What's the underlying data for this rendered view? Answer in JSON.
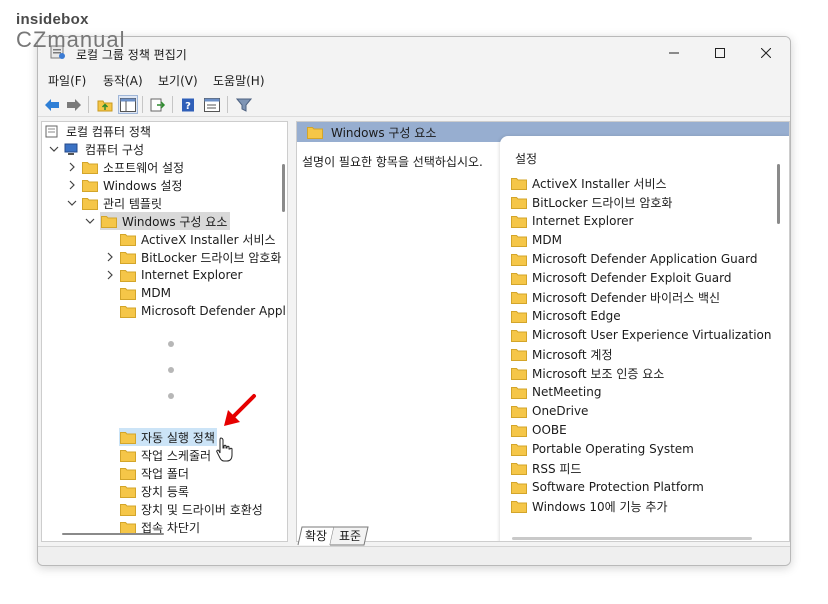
{
  "watermark": {
    "line1": "insidebox",
    "line2": "CZmanual"
  },
  "window": {
    "title": "로컬 그룹 정책 편집기"
  },
  "menu": [
    "파일(F)",
    "동작(A)",
    "보기(V)",
    "도움말(H)"
  ],
  "colors": {
    "header_band": "#97aed0",
    "selected_row": "#d9d9d9",
    "hover_row": "#cce4f7",
    "folder": "#f5c648",
    "arrow": "#e60000"
  },
  "tree": {
    "root": "로컬 컴퓨터 정책",
    "computer_config": "컴퓨터 구성",
    "software_settings": "소프트웨어 설정",
    "windows_settings": "Windows 설정",
    "admin_templates": "관리 템플릿",
    "windows_components": "Windows 구성 요소",
    "items_top": [
      "ActiveX Installer 서비스",
      "BitLocker 드라이브 암호화",
      "Internet Explorer",
      "MDM",
      "Microsoft Defender Appl"
    ],
    "items_bottom": [
      "자동 실행 정책",
      "작업 스케줄러",
      "작업 폴더",
      "장치 등록",
      "장치 및 드라이버 호환성",
      "접속 차단기"
    ]
  },
  "right": {
    "header": "Windows 구성 요소",
    "description": "설명이 필요한 항목을 선택하십시오.",
    "list_header": "설정",
    "items": [
      "ActiveX Installer 서비스",
      "BitLocker 드라이브 암호화",
      "Internet Explorer",
      "MDM",
      "Microsoft Defender Application Guard",
      "Microsoft Defender Exploit Guard",
      "Microsoft Defender 바이러스 백신",
      "Microsoft Edge",
      "Microsoft User Experience Virtualization",
      "Microsoft 계정",
      "Microsoft 보조 인증 요소",
      "NetMeeting",
      "OneDrive",
      "OOBE",
      "Portable Operating System",
      "RSS 피드",
      "Software Protection Platform",
      "Windows 10에 기능 추가"
    ]
  },
  "tabs": [
    "확장",
    "표준"
  ]
}
